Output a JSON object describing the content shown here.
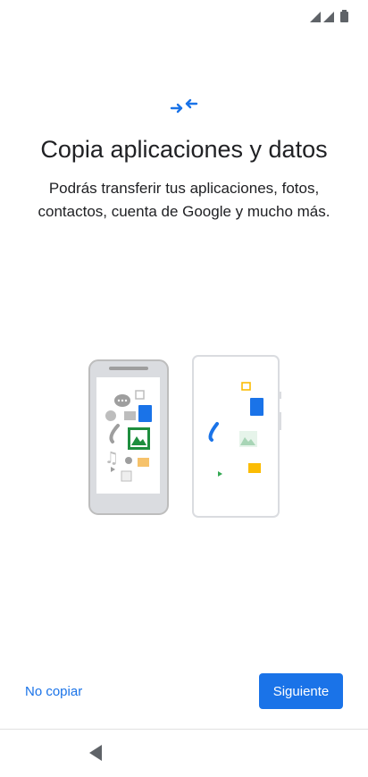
{
  "screen": {
    "title": "Copia aplicaciones y datos",
    "subtitle": "Podrás transferir tus aplicaciones, fotos, contactos, cuenta de Google y mucho más."
  },
  "actions": {
    "skip_label": "No copiar",
    "next_label": "Siguiente"
  },
  "icons": {
    "header": "transfer-arrows-icon",
    "navigation": "back-triangle-icon",
    "status": [
      "signal-icon",
      "signal-icon",
      "battery-icon"
    ]
  },
  "colors": {
    "accent": "#1a73e8",
    "text": "#202124",
    "illustration_grey": "#bdbdbd"
  }
}
